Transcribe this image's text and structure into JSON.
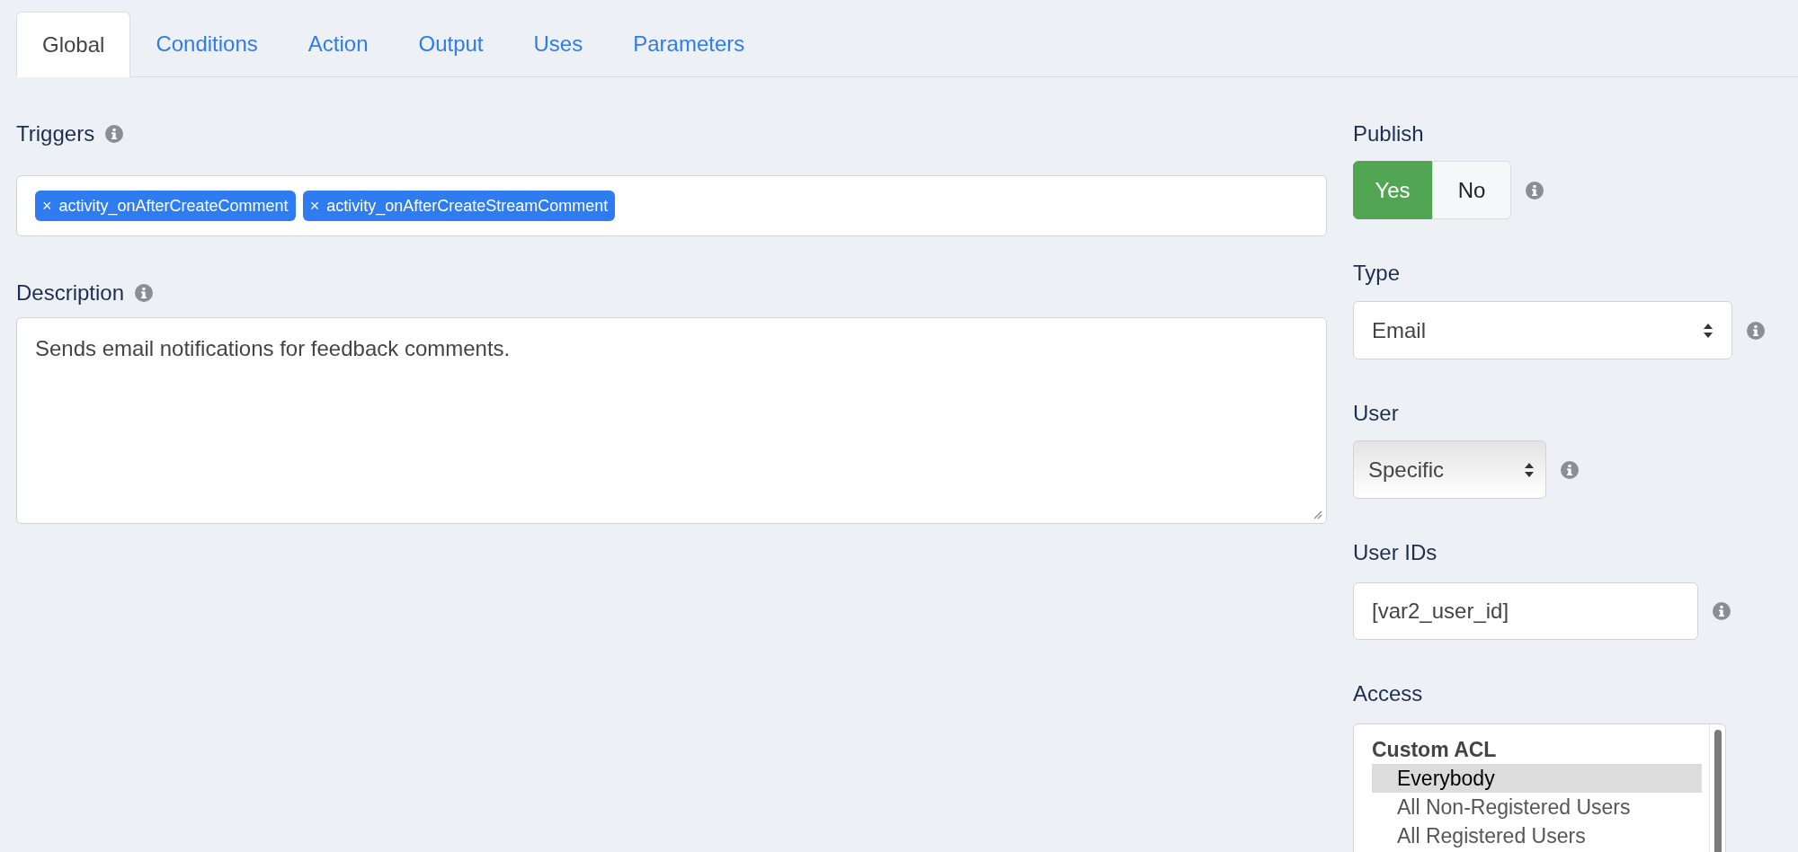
{
  "tabs": [
    {
      "label": "Global",
      "selected": true
    },
    {
      "label": "Conditions",
      "selected": false
    },
    {
      "label": "Action",
      "selected": false
    },
    {
      "label": "Output",
      "selected": false
    },
    {
      "label": "Uses",
      "selected": false
    },
    {
      "label": "Parameters",
      "selected": false
    }
  ],
  "triggers": {
    "label": "Triggers",
    "tags": [
      {
        "remove": "×",
        "text": "activity_onAfterCreateComment"
      },
      {
        "remove": "×",
        "text": "activity_onAfterCreateStreamComment"
      }
    ]
  },
  "description": {
    "label": "Description",
    "value": "Sends email notifications for feedback comments."
  },
  "publish": {
    "label": "Publish",
    "options": [
      {
        "label": "Yes",
        "selected": true
      },
      {
        "label": "No",
        "selected": false
      }
    ]
  },
  "type": {
    "label": "Type",
    "value": "Email"
  },
  "user": {
    "label": "User",
    "value": "Specific"
  },
  "user_ids": {
    "label": "User IDs",
    "value": "[var2_user_id]"
  },
  "access": {
    "label": "Access",
    "group": "Custom ACL",
    "options": [
      {
        "label": "Everybody",
        "selected": true
      },
      {
        "label": "All Non-Registered Users",
        "selected": false
      },
      {
        "label": "All Registered Users",
        "selected": false
      }
    ]
  }
}
